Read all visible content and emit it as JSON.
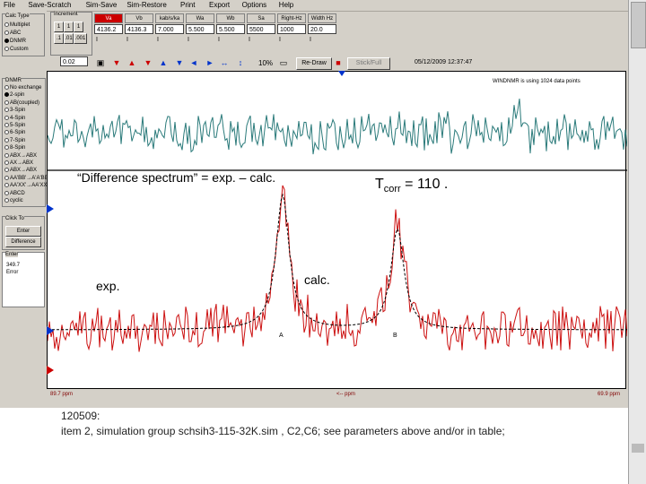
{
  "menu": [
    "File",
    "Save-Scratch",
    "Sim-Save",
    "Sim-Restore",
    "Print",
    "Export",
    "Options",
    "Help"
  ],
  "calc_type": {
    "title": "Calc Type",
    "options": [
      {
        "label": "Multiplet",
        "selected": false
      },
      {
        "label": "ABC",
        "selected": false
      },
      {
        "label": "DNMR",
        "selected": true
      },
      {
        "label": "Custom",
        "selected": false
      }
    ]
  },
  "increment": {
    "label": "Increment",
    "value": "0.02"
  },
  "param_columns": [
    {
      "head": "Va",
      "value": "4136.2",
      "highlight": true
    },
    {
      "head": "Vb",
      "value": "4136.3"
    },
    {
      "head": "kab/s/ka",
      "value": "7.000"
    },
    {
      "head": "Wa",
      "value": "5.500"
    },
    {
      "head": "Wb",
      "value": "5.500"
    },
    {
      "head": "Sa",
      "value": "5500"
    },
    {
      "head": "Right-Hz",
      "value": "1000"
    },
    {
      "head": "Width Hz",
      "value": "20.0"
    }
  ],
  "dnmr": {
    "title": "DNMR",
    "options": [
      "No exchange",
      "2-spin",
      "AB(coupled)",
      "3-Spin",
      "4-Spin",
      "5-Spin",
      "6-Spin",
      "7-Spin",
      "8-Spin",
      "ABX→ABX",
      "AX→ABX",
      "ABX→ABX",
      "AA'BB'→A'A'BB'",
      "AA'XX'→AA'XX'",
      "ABCD",
      "cyclic"
    ]
  },
  "click_to": {
    "title": "Click To",
    "items": [
      "Enter",
      "Difference"
    ]
  },
  "enter_box": {
    "title": "Enter",
    "value": "349.7",
    "unit": "Error"
  },
  "toolbar": {
    "zoom": "10%",
    "redraw": "Re-Draw",
    "stick": "Stick/Full"
  },
  "timestamp": "05/12/2009 12:37:47",
  "plot": {
    "info": "WINDNMR is using 1024 data points",
    "difference_label": "“Difference spectrum” = exp. – calc.",
    "tcorr_prefix": "T",
    "tcorr_sub": "corr",
    "tcorr_suffix": " = 110 .",
    "exp_label": "exp.",
    "calc_label": "calc.",
    "axis_left": "89.7 ppm",
    "axis_mid": "<-- ppm",
    "axis_right": "69.9 ppm",
    "peak_a": "A",
    "peak_b": "B",
    "colors": {
      "difference": "#2a7a7a",
      "experimental": "#cc1010",
      "simulated": "#000000"
    }
  },
  "caption": {
    "line1": "120509:",
    "line2": "item 2, simulation group schsih3-115-32K.sim , C2,C6; see parameters above and/or in table;"
  }
}
